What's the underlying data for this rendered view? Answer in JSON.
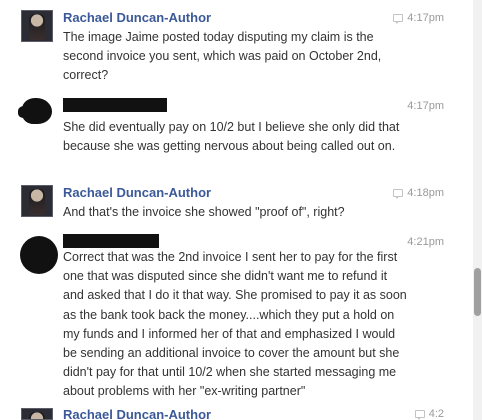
{
  "messages": [
    {
      "author": "Rachael Duncan-Author",
      "time": "4:17pm",
      "text": "The image Jaime posted today disputing my claim is the second invoice you sent, which was paid on October 2nd, correct?"
    },
    {
      "author": "",
      "time": "4:17pm",
      "text": "She did eventually pay on 10/2 but I believe she only did that because she was getting nervous about being called out on."
    },
    {
      "author": "Rachael Duncan-Author",
      "time": "4:18pm",
      "text": "And that's the invoice she showed \"proof of\", right?"
    },
    {
      "author": "",
      "time": "4:21pm",
      "text": "Correct that was the 2nd invoice I sent her to pay for the first one that was disputed since she didn't want me to refund it and asked that I do it that way. She promised to pay it as soon as the bank took back the money....which they put a hold on my funds and I informed her of that and emphasized I would be sending an additional invoice to cover the amount but she didn't pay for that until 10/2 when she started messaging me about problems with her \"ex-writing partner\""
    },
    {
      "author": "Rachael Duncan-Author",
      "time": "4:2",
      "text": ""
    }
  ],
  "colors": {
    "author_link": "#3b5998",
    "body_text": "#333333",
    "timestamp": "#999999"
  }
}
